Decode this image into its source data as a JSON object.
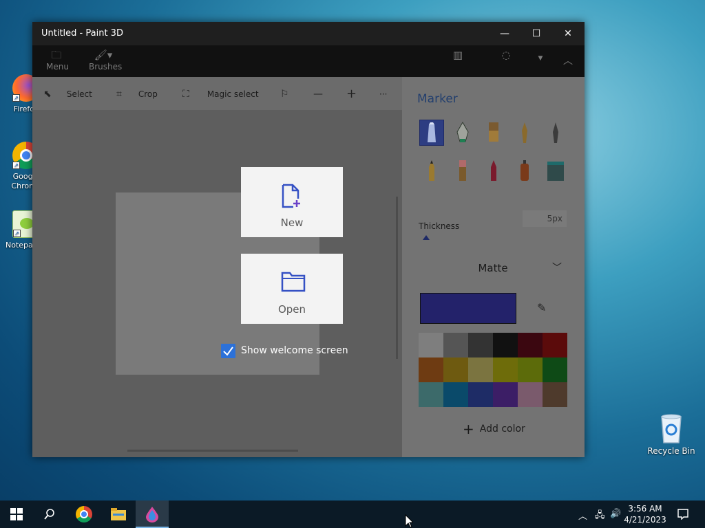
{
  "desktop": {
    "icons": [
      {
        "label": "Firefox",
        "icon": "firefox-icon"
      },
      {
        "label": "Google Chrome",
        "icon": "chrome-icon"
      },
      {
        "label": "Notepad++",
        "icon": "notepadpp-icon"
      }
    ],
    "recycle_bin": "Recycle Bin"
  },
  "window": {
    "title": "Untitled - Paint 3D",
    "controls": {
      "minimize": "minimize-icon",
      "maximize": "maximize-icon",
      "close": "close-icon"
    }
  },
  "ribbon": {
    "menu": "Menu",
    "brushes": "Brushes"
  },
  "toolbar": {
    "select": "Select",
    "crop": "Crop",
    "magic_select": "Magic select",
    "more": "···"
  },
  "panel": {
    "title": "Marker",
    "thickness_label": "Thickness",
    "thickness_value": "5px",
    "finish": "Matte",
    "current_color": "#23226a",
    "add_color": "Add color",
    "palette": [
      "#7e7e7e",
      "#555555",
      "#333333",
      "#111111",
      "#3b0710",
      "#5b0b0b",
      "#6e3b12",
      "#6e5a10",
      "#7b7440",
      "#6e6c0a",
      "#5c6b0a",
      "#0e4a16",
      "#3c6a6a",
      "#0a4a6a",
      "#1e2c66",
      "#3c1e66",
      "#7a5a6c",
      "#4e3a2c"
    ]
  },
  "welcome": {
    "new_label": "New",
    "open_label": "Open",
    "show_welcome": "Show welcome screen"
  },
  "taskbar": {
    "time": "3:56 AM",
    "date": "4/21/2023"
  }
}
